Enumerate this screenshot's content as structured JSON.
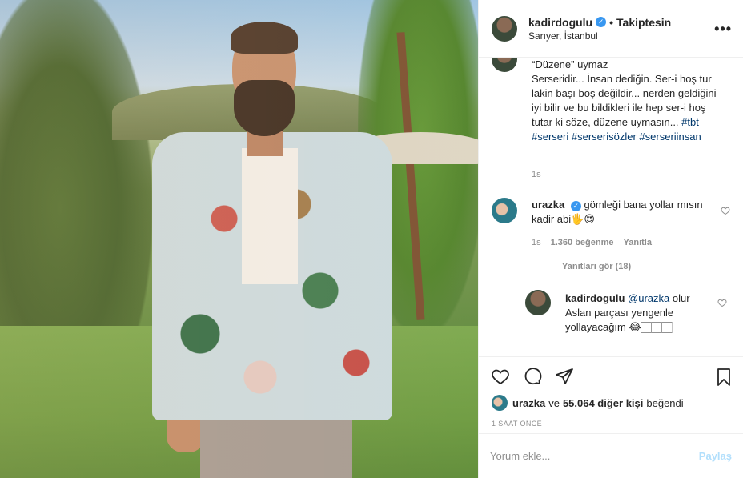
{
  "post": {
    "username": "kadirdogulu",
    "follow_status": "Takiptesin",
    "separator": "•",
    "location": "Sarıyer, İstanbul",
    "more_label": "•••"
  },
  "caption": {
    "line_quote": "“Düzene” uymaz",
    "text": "Serseridir... İnsan dediğin. Ser-i hoş tur lakin başı boş değildir... nerden geldiğini iyi bilir ve bu bildikleri ile hep ser-i hoş tutar ki söze, düzene uymasın...",
    "hashtags": [
      "#tbt",
      "#serseri",
      "#serserisözler",
      "#serseriinsan"
    ],
    "time": "1s"
  },
  "comments": [
    {
      "username": "urazka",
      "text": "gömleği bana yollar mısın kadir abi🖐😍",
      "time": "1s",
      "likes": "1.360 beğenme",
      "reply_label": "Yanıtla"
    }
  ],
  "view_replies": "Yanıtları gör (18)",
  "reply": {
    "username": "kadirdogulu",
    "mention": "@urazka",
    "text": "olur Aslan parçası yengenle yollayacağım 😂🏻🏻🏻"
  },
  "likes_summary": {
    "first_user": "urazka",
    "connector": "ve",
    "others": "55.064 diğer kişi",
    "suffix": "beğendi"
  },
  "timestamp": "1 SAAT ÖNCE",
  "add_comment": {
    "placeholder": "Yorum ekle...",
    "post_label": "Paylaş"
  },
  "colors": {
    "verified": "#3897f0",
    "hashtag": "#00376b",
    "muted": "#8e8e8e",
    "post_disabled": "#b2dffc"
  },
  "icons": [
    "verified-badge-icon",
    "more-icon",
    "heart-icon",
    "comment-icon",
    "share-icon",
    "bookmark-icon"
  ]
}
